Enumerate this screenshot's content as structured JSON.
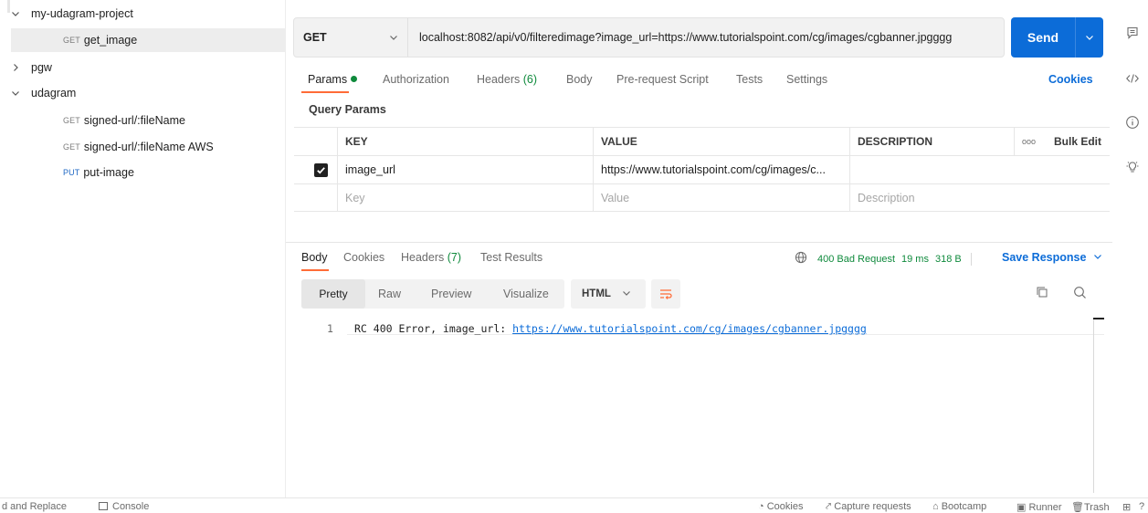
{
  "sidebar": {
    "items": [
      {
        "label": "my-udagram-project",
        "type": "folder",
        "expanded": true
      },
      {
        "label": "get_image",
        "method": "GET",
        "selected": true
      },
      {
        "label": "pgw",
        "type": "folder",
        "expanded": false
      },
      {
        "label": "udagram",
        "type": "folder",
        "expanded": true
      },
      {
        "label": "signed-url/:fileName",
        "method": "GET"
      },
      {
        "label": "signed-url/:fileName AWS",
        "method": "GET"
      },
      {
        "label": "put-image",
        "method": "PUT"
      }
    ]
  },
  "request": {
    "method": "GET",
    "url": "localhost:8082/api/v0/filteredimage?image_url=https://www.tutorialspoint.com/cg/images/cgbanner.jpgggg",
    "send_label": "Send"
  },
  "request_tabs": {
    "params": "Params",
    "authorization": "Authorization",
    "headers": "Headers",
    "headers_count": "(6)",
    "body": "Body",
    "prerequest": "Pre-request Script",
    "tests": "Tests",
    "settings": "Settings",
    "cookies": "Cookies"
  },
  "query_params": {
    "title": "Query Params",
    "columns": {
      "key": "KEY",
      "value": "VALUE",
      "description": "DESCRIPTION",
      "more": "ooo",
      "bulk_edit": "Bulk Edit"
    },
    "rows": [
      {
        "checked": true,
        "key": "image_url",
        "value": "https://www.tutorialspoint.com/cg/images/c...",
        "description": ""
      }
    ],
    "placeholders": {
      "key": "Key",
      "value": "Value",
      "description": "Description"
    }
  },
  "response": {
    "tabs": {
      "body": "Body",
      "cookies": "Cookies",
      "headers": "Headers",
      "headers_count": "(7)",
      "test_results": "Test Results"
    },
    "status": "400 Bad Request",
    "time": "19 ms",
    "size": "318 B",
    "save_label": "Save Response",
    "formats": {
      "pretty": "Pretty",
      "raw": "Raw",
      "preview": "Preview",
      "visualize": "Visualize"
    },
    "language": "HTML",
    "line_number": "1",
    "code_prefix": "RC 400 Error, image_url: ",
    "code_link": "https://www.tutorialspoint.com/cg/images/cgbanner.jpgggg"
  },
  "statusbar": {
    "find_replace": "d and Replace",
    "console": "Console",
    "cookies": "Cookies",
    "capture": "Capture requests",
    "bootcamp": "Bootcamp",
    "runner": "Runner",
    "trash": "Trash"
  },
  "colors": {
    "accent": "#ff6c37",
    "send": "#0c6cd8",
    "success": "#0f8a3c"
  }
}
